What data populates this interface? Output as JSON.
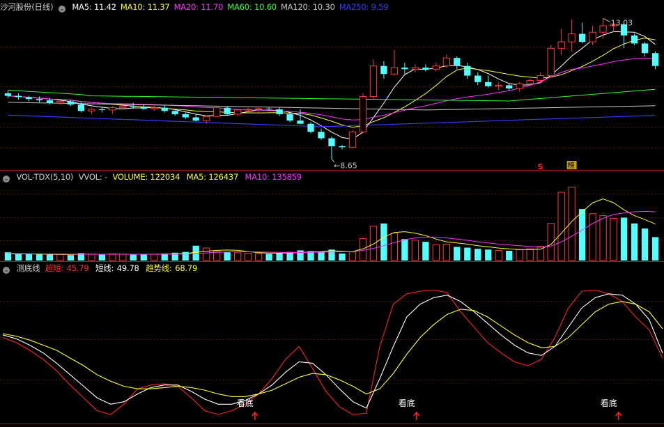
{
  "price_panel": {
    "stock": "沙河股份(日线)",
    "ma": [
      {
        "label": "MA5:",
        "value": "11.42",
        "color": "#ffffff"
      },
      {
        "label": "MA10:",
        "value": "11.37",
        "color": "#ffff33"
      },
      {
        "label": "MA20:",
        "value": "11.70",
        "color": "#ff33ff"
      },
      {
        "label": "MA60:",
        "value": "10.60",
        "color": "#33ff33"
      },
      {
        "label": "MA120:",
        "value": "10.30",
        "color": "#c8c8c8"
      },
      {
        "label": "MA250:",
        "value": "9.59",
        "color": "#3a3aff"
      }
    ],
    "high_label": "13.03",
    "low_label": "8.65",
    "marker_s": "S",
    "marker_bang": "榜"
  },
  "volume_panel": {
    "name": "VOL-TDX(5,10)",
    "vvol": "VVOL: -",
    "volume": "VOLUME: 122034",
    "ma5": "MA5: 126437",
    "ma10": "MA10: 135859"
  },
  "indicator_panel": {
    "name": "测底线",
    "super_short": {
      "label": "超短:",
      "value": "45.79"
    },
    "short": {
      "label": "短线:",
      "value": "49.78"
    },
    "trend": {
      "label": "趋势线:",
      "value": "68.79"
    },
    "bottom_label": "看底",
    "bottom_signals": [
      18,
      30,
      45
    ]
  },
  "chart_data": [
    {
      "type": "candlestick",
      "title": "沙河股份(日线)",
      "ylim": [
        8.4,
        13.3
      ],
      "candles": [
        [
          10.7,
          10.78,
          10.55,
          10.62
        ],
        [
          10.62,
          10.7,
          10.5,
          10.58
        ],
        [
          10.58,
          10.62,
          10.45,
          10.52
        ],
        [
          10.52,
          10.6,
          10.42,
          10.48
        ],
        [
          10.48,
          10.55,
          10.35,
          10.4
        ],
        [
          10.4,
          10.5,
          10.35,
          10.45
        ],
        [
          10.45,
          10.5,
          10.3,
          10.35
        ],
        [
          10.35,
          10.42,
          10.1,
          10.15
        ],
        [
          10.15,
          10.25,
          10.05,
          10.2
        ],
        [
          10.2,
          10.28,
          10.1,
          10.18
        ],
        [
          10.18,
          10.3,
          10.05,
          10.25
        ],
        [
          10.25,
          10.35,
          10.2,
          10.3
        ],
        [
          10.3,
          10.4,
          10.22,
          10.28
        ],
        [
          10.28,
          10.35,
          10.18,
          10.22
        ],
        [
          10.22,
          10.3,
          10.15,
          10.25
        ],
        [
          10.25,
          10.32,
          10.1,
          10.15
        ],
        [
          10.15,
          10.2,
          10.0,
          10.05
        ],
        [
          10.05,
          10.12,
          9.9,
          9.95
        ],
        [
          9.95,
          10.05,
          9.82,
          9.85
        ],
        [
          9.85,
          10.0,
          9.75,
          9.98
        ],
        [
          9.98,
          10.3,
          9.95,
          10.25
        ],
        [
          10.25,
          10.3,
          10.0,
          10.05
        ],
        [
          10.05,
          10.22,
          10.0,
          10.18
        ],
        [
          10.18,
          10.25,
          10.1,
          10.2
        ],
        [
          10.2,
          10.28,
          10.1,
          10.22
        ],
        [
          10.22,
          10.26,
          10.15,
          10.2
        ],
        [
          10.2,
          10.25,
          10.0,
          10.05
        ],
        [
          10.05,
          10.1,
          9.8,
          9.85
        ],
        [
          9.85,
          10.2,
          9.75,
          9.75
        ],
        [
          9.75,
          9.8,
          9.45,
          9.5
        ],
        [
          9.5,
          9.6,
          9.25,
          9.3
        ],
        [
          9.3,
          9.35,
          8.65,
          9.05
        ],
        [
          9.05,
          9.1,
          8.95,
          9.02
        ],
        [
          9.02,
          9.55,
          9.0,
          9.5
        ],
        [
          9.5,
          10.7,
          9.45,
          10.6
        ],
        [
          10.6,
          11.75,
          10.5,
          11.55
        ],
        [
          11.55,
          11.7,
          11.15,
          11.3
        ],
        [
          11.3,
          12.05,
          11.25,
          11.5
        ],
        [
          11.5,
          11.65,
          11.3,
          11.45
        ],
        [
          11.45,
          11.6,
          11.35,
          11.5
        ],
        [
          11.5,
          11.6,
          11.38,
          11.45
        ],
        [
          11.45,
          11.65,
          11.38,
          11.55
        ],
        [
          11.55,
          11.9,
          11.5,
          11.8
        ],
        [
          11.8,
          11.85,
          11.45,
          11.55
        ],
        [
          11.55,
          11.65,
          11.15,
          11.25
        ],
        [
          11.25,
          11.35,
          10.95,
          11.05
        ],
        [
          11.05,
          11.25,
          10.88,
          10.92
        ],
        [
          10.92,
          11.05,
          10.8,
          10.95
        ],
        [
          10.95,
          11.0,
          10.78,
          10.85
        ],
        [
          10.85,
          11.05,
          10.75,
          11.0
        ],
        [
          11.0,
          11.15,
          10.95,
          11.1
        ],
        [
          11.1,
          11.35,
          11.0,
          11.25
        ],
        [
          11.25,
          12.2,
          11.2,
          12.1
        ],
        [
          12.1,
          12.7,
          11.9,
          12.3
        ],
        [
          12.3,
          13.0,
          12.0,
          12.55
        ],
        [
          12.55,
          12.9,
          12.25,
          12.3
        ],
        [
          12.3,
          12.8,
          12.2,
          12.6
        ],
        [
          12.6,
          13.03,
          12.4,
          12.8
        ],
        [
          12.8,
          12.95,
          12.6,
          12.85
        ],
        [
          12.85,
          12.95,
          12.1,
          12.5
        ],
        [
          12.5,
          12.55,
          12.2,
          12.25
        ],
        [
          12.25,
          12.3,
          11.85,
          11.95
        ],
        [
          11.95,
          12.0,
          11.45,
          11.55
        ]
      ]
    },
    {
      "type": "bar",
      "title": "VOL-TDX(5,10)",
      "ylim": [
        0,
        200000
      ],
      "values": [
        21000,
        18000,
        16000,
        17000,
        15000,
        16000,
        14000,
        19000,
        16000,
        15000,
        17000,
        16000,
        15000,
        17000,
        16000,
        18000,
        20000,
        22000,
        38000,
        32000,
        24000,
        21000,
        20000,
        19000,
        18000,
        17000,
        19000,
        22000,
        26000,
        24000,
        23000,
        28000,
        18000,
        22000,
        56000,
        88000,
        95000,
        70000,
        55000,
        52000,
        48000,
        40000,
        42000,
        35000,
        33000,
        30000,
        28000,
        26000,
        25000,
        28000,
        30000,
        36000,
        95000,
        175000,
        188000,
        132000,
        120000,
        115000,
        108000,
        110000,
        95000,
        82000,
        60000
      ],
      "series": [
        {
          "name": "MA5",
          "values": [
            17000,
            17200,
            17000,
            16500,
            16000,
            15800,
            15600,
            16000,
            16200,
            16000,
            16200,
            16300,
            16000,
            16000,
            16200,
            16500,
            17000,
            18000,
            21000,
            24000,
            26000,
            27000,
            26000,
            23000,
            20000,
            19000,
            19000,
            19500,
            20500,
            22000,
            23000,
            25000,
            24000,
            23000,
            30000,
            42000,
            60000,
            72000,
            74000,
            70000,
            64000,
            55000,
            48000,
            45000,
            42000,
            38000,
            35000,
            32000,
            30000,
            28000,
            28000,
            29000,
            41000,
            70000,
            100000,
            125000,
            148000,
            158000,
            148000,
            130000,
            115000,
            105000,
            94000
          ]
        },
        {
          "name": "MA10",
          "values": [
            18000,
            17800,
            17500,
            17200,
            17000,
            16800,
            16500,
            16300,
            16200,
            16000,
            16000,
            16000,
            16000,
            16000,
            16000,
            16000,
            16300,
            16800,
            18000,
            19500,
            21000,
            22000,
            22500,
            22500,
            22000,
            21500,
            21000,
            20500,
            20500,
            21000,
            21500,
            22000,
            22500,
            23000,
            26000,
            31000,
            38000,
            46000,
            53000,
            58000,
            60000,
            60000,
            58000,
            55000,
            52000,
            48000,
            45000,
            42000,
            40000,
            38000,
            36000,
            34000,
            37000,
            48000,
            62000,
            78000,
            95000,
            108000,
            118000,
            122000,
            125000,
            126000,
            125000
          ]
        }
      ]
    },
    {
      "type": "line",
      "title": "测底线",
      "ylim": [
        -5,
        110
      ],
      "series": [
        {
          "name": "超短",
          "values": [
            62,
            58,
            52,
            45,
            36,
            25,
            15,
            5,
            2,
            10,
            22,
            25,
            26,
            24,
            15,
            5,
            2,
            5,
            10,
            18,
            30,
            45,
            55,
            38,
            20,
            8,
            2,
            3,
            55,
            88,
            96,
            98,
            99,
            97,
            82,
            70,
            58,
            50,
            43,
            40,
            45,
            62,
            85,
            98,
            99,
            96,
            90,
            78,
            68,
            45.79
          ]
        },
        {
          "name": "短线",
          "values": [
            64,
            61,
            56,
            50,
            42,
            33,
            24,
            15,
            10,
            12,
            18,
            23,
            25,
            25,
            20,
            14,
            10,
            10,
            13,
            18,
            25,
            35,
            43,
            42,
            33,
            22,
            12,
            7,
            30,
            55,
            78,
            88,
            93,
            95,
            90,
            82,
            73,
            64,
            56,
            50,
            48,
            55,
            70,
            85,
            93,
            96,
            95,
            88,
            76,
            49.78
          ]
        },
        {
          "name": "趋势线",
          "values": [
            65,
            63,
            60,
            56,
            52,
            46,
            40,
            33,
            28,
            24,
            22,
            22,
            23,
            24,
            23,
            21,
            18,
            16,
            16,
            18,
            21,
            26,
            31,
            34,
            33,
            29,
            24,
            18,
            22,
            34,
            49,
            62,
            72,
            80,
            84,
            83,
            78,
            71,
            64,
            58,
            54,
            55,
            62,
            72,
            82,
            88,
            90,
            88,
            82,
            68.79
          ]
        }
      ]
    }
  ]
}
